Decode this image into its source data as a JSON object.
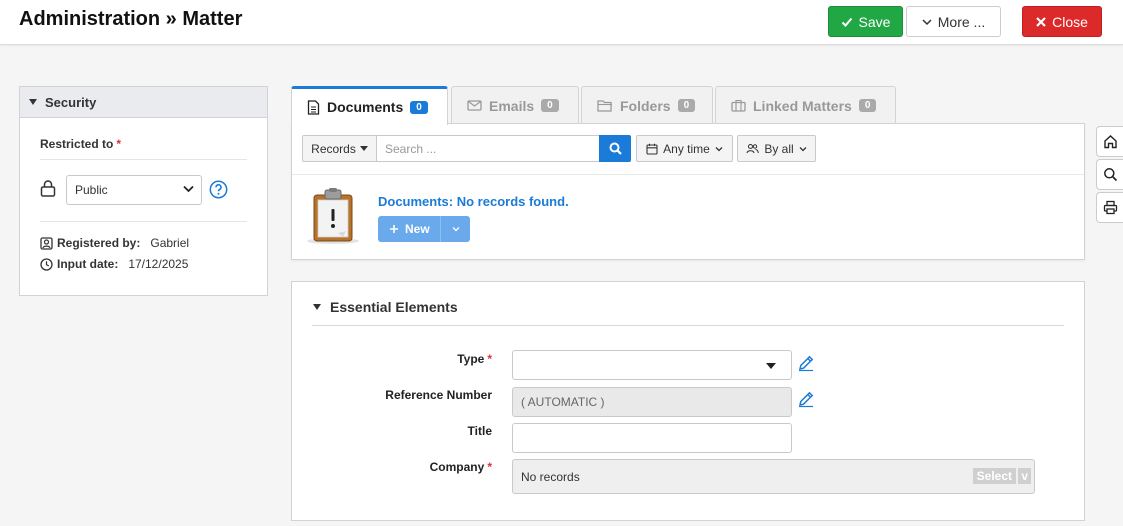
{
  "header": {
    "title": "Administration » Matter",
    "save_label": "Save",
    "more_label": "More ...",
    "close_label": "Close"
  },
  "security": {
    "title": "Security",
    "restricted_label": "Restricted to",
    "required_mark": "*",
    "access_value": "Public",
    "registered_by_label": "Registered by:",
    "registered_by_value": "Gabriel",
    "input_date_label": "Input date:",
    "input_date_value": "17/12/2025"
  },
  "tabs": [
    {
      "label": "Documents",
      "count": "0",
      "active": true
    },
    {
      "label": "Emails",
      "count": "0",
      "active": false
    },
    {
      "label": "Folders",
      "count": "0",
      "active": false
    },
    {
      "label": "Linked Matters",
      "count": "0",
      "active": false
    }
  ],
  "documents": {
    "records_label": "Records",
    "search_placeholder": "Search ...",
    "any_time_label": "Any time",
    "by_all_label": "By all",
    "empty_message": "Documents: No records found.",
    "new_label": "New"
  },
  "essential": {
    "title": "Essential Elements",
    "fields": {
      "type_label": "Type",
      "reference_label": "Reference Number",
      "reference_value": "( AUTOMATIC )",
      "title_label": "Title",
      "company_label": "Company",
      "company_value": "No records",
      "company_select": "Select",
      "company_toggle": "v"
    }
  },
  "colors": {
    "primary": "#1a7bd8",
    "success": "#22a745",
    "danger": "#dc2a2a"
  }
}
